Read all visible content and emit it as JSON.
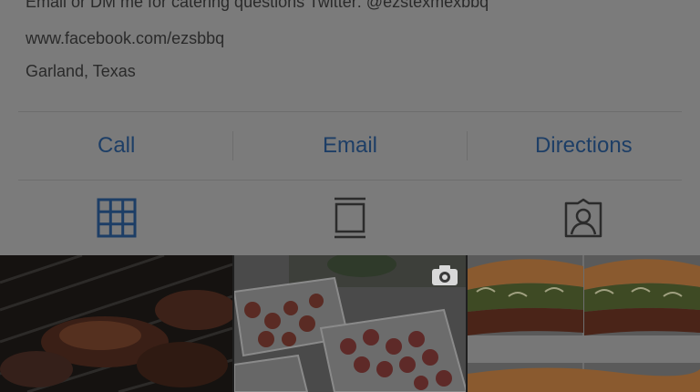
{
  "bio": {
    "line1": "Email or DM me for catering questions Twitter: @ezstexmexbbq",
    "line2": "www.facebook.com/ezsbbq",
    "line3": "Garland, Texas"
  },
  "actions": {
    "call": "Call",
    "email": "Email",
    "directions": "Directions"
  },
  "tabs": [
    {
      "icon": "grid-icon",
      "active": true
    },
    {
      "icon": "feed-icon",
      "active": false
    },
    {
      "icon": "tagged-person-icon",
      "active": false
    }
  ],
  "posts": [
    {
      "subject": "brisket-on-smoker"
    },
    {
      "subject": "sausage-trays",
      "badge": "camera-icon"
    },
    {
      "subject": "tortas-sandwiches"
    }
  ],
  "colors": {
    "overlay": "#7b7b7b",
    "link_blue": "#1d3e66",
    "active_tab": "#1d3e66",
    "inactive_tab": "#2b2b2b"
  }
}
